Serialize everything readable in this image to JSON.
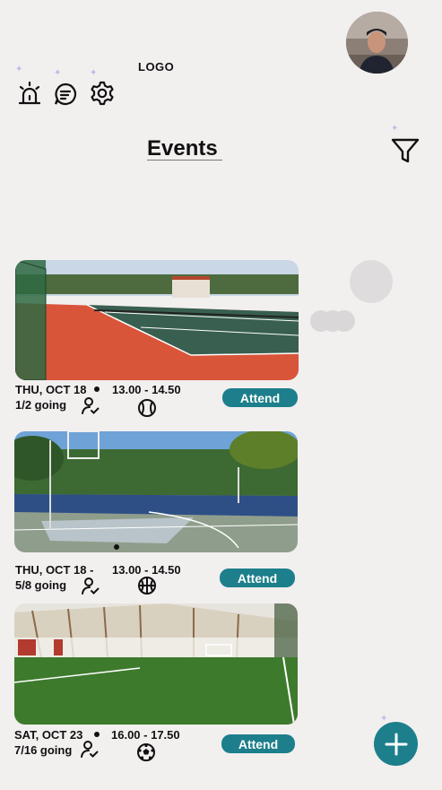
{
  "header": {
    "logo_text": "LOGO",
    "icons": [
      "alarm-icon",
      "chat-icon",
      "settings-icon"
    ]
  },
  "page": {
    "title": "Events"
  },
  "events": [
    {
      "date": "THU, OCT 18",
      "time": "13.00 - 14.50",
      "going": "1/2 going",
      "sport": "tennis",
      "attend_label": "Attend"
    },
    {
      "date": "THU, OCT 18 -",
      "time": "13.00 - 14.50",
      "going": "5/8 going",
      "sport": "basketball",
      "attend_label": "Attend"
    },
    {
      "date": "SAT, OCT 23",
      "time": "16.00 - 17.50",
      "going": "7/16 going",
      "sport": "football",
      "attend_label": "Attend"
    }
  ],
  "colors": {
    "accent": "#1c7f8b",
    "background": "#f2efef"
  },
  "fab": {
    "icon": "plus-icon"
  }
}
